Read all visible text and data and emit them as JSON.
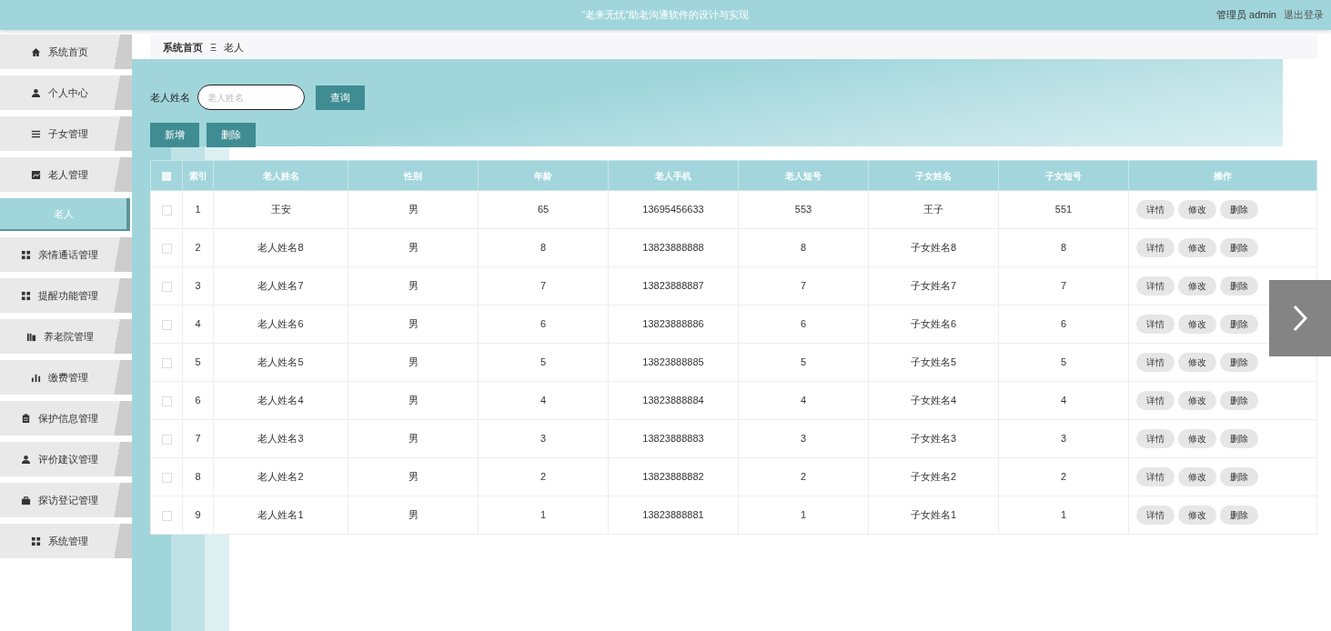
{
  "header": {
    "title": "“老来无忧”助老沟通软件的设计与实现",
    "user": "管理员 admin",
    "logout": "退出登录"
  },
  "sidebar": {
    "items": [
      {
        "label": "系统首页",
        "kind": "menu",
        "selected": false
      },
      {
        "label": "个人中心",
        "kind": "menu",
        "selected": false
      },
      {
        "label": "子女管理",
        "kind": "menu",
        "selected": false
      },
      {
        "label": "老人管理",
        "kind": "menu",
        "selected": false
      },
      {
        "label": "老人",
        "kind": "submenu",
        "selected": true
      },
      {
        "label": "亲情通话管理",
        "kind": "menu",
        "selected": false
      },
      {
        "label": "提醒功能管理",
        "kind": "menu",
        "selected": false
      },
      {
        "label": "养老院管理",
        "kind": "menu",
        "selected": false
      },
      {
        "label": "缴费管理",
        "kind": "menu",
        "selected": false
      },
      {
        "label": "保护信息管理",
        "kind": "menu",
        "selected": false
      },
      {
        "label": "评价建议管理",
        "kind": "menu",
        "selected": false
      },
      {
        "label": "探访登记管理",
        "kind": "menu",
        "selected": false
      },
      {
        "label": "系统管理",
        "kind": "menu",
        "selected": false
      }
    ]
  },
  "breadcrumb": {
    "home": "系统首页",
    "separator": "Ξ",
    "current": "老人"
  },
  "search": {
    "label": "老人姓名",
    "placeholder": "老人姓名",
    "button": "查询"
  },
  "toolbar": {
    "buttons": [
      "新增",
      "删除"
    ]
  },
  "table": {
    "header_checked": false,
    "columns": [
      "索引",
      "老人姓名",
      "性别",
      "年龄",
      "老人手机",
      "老人短号",
      "子女姓名",
      "子女短号",
      "操作"
    ],
    "rows": [
      {
        "checked": false,
        "cells": [
          "1",
          "王安",
          "男",
          "65",
          "13695456633",
          "553",
          "王子",
          "551"
        ],
        "actions": [
          "详情",
          "修改",
          "删除"
        ]
      },
      {
        "checked": false,
        "cells": [
          "2",
          "老人姓名8",
          "男",
          "8",
          "13823888888",
          "8",
          "子女姓名8",
          "8"
        ],
        "actions": [
          "详情",
          "修改",
          "删除"
        ]
      },
      {
        "checked": false,
        "cells": [
          "3",
          "老人姓名7",
          "男",
          "7",
          "13823888887",
          "7",
          "子女姓名7",
          "7"
        ],
        "actions": [
          "详情",
          "修改",
          "删除"
        ]
      },
      {
        "checked": false,
        "cells": [
          "4",
          "老人姓名6",
          "男",
          "6",
          "13823888886",
          "6",
          "子女姓名6",
          "6"
        ],
        "actions": [
          "详情",
          "修改",
          "删除"
        ]
      },
      {
        "checked": false,
        "cells": [
          "5",
          "老人姓名5",
          "男",
          "5",
          "13823888885",
          "5",
          "子女姓名5",
          "5"
        ],
        "actions": [
          "详情",
          "修改",
          "删除"
        ]
      },
      {
        "checked": false,
        "cells": [
          "6",
          "老人姓名4",
          "男",
          "4",
          "13823888884",
          "4",
          "子女姓名4",
          "4"
        ],
        "actions": [
          "详情",
          "修改",
          "删除"
        ]
      },
      {
        "checked": false,
        "cells": [
          "7",
          "老人姓名3",
          "男",
          "3",
          "13823888883",
          "3",
          "子女姓名3",
          "3"
        ],
        "actions": [
          "详情",
          "修改",
          "删除"
        ]
      },
      {
        "checked": false,
        "cells": [
          "8",
          "老人姓名2",
          "男",
          "2",
          "13823888882",
          "2",
          "子女姓名2",
          "2"
        ],
        "actions": [
          "详情",
          "修改",
          "删除"
        ]
      },
      {
        "checked": false,
        "cells": [
          "9",
          "老人姓名1",
          "男",
          "1",
          "13823888881",
          "1",
          "子女姓名1",
          "1"
        ],
        "actions": [
          "详情",
          "修改",
          "删除"
        ]
      }
    ]
  }
}
